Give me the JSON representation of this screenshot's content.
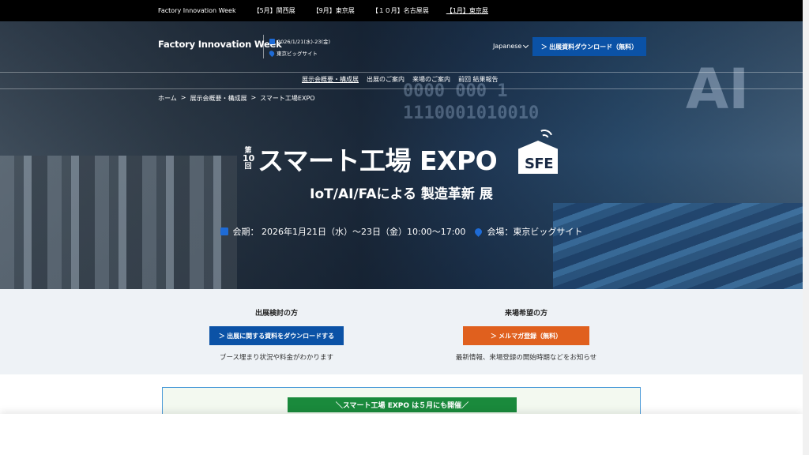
{
  "topbar": {
    "links": [
      {
        "label": "Factory Innovation Week",
        "active": false
      },
      {
        "label": "【5月】関西展",
        "active": false
      },
      {
        "label": "【9月】東京展",
        "active": false
      },
      {
        "label": "【１０月】名古屋展",
        "active": false
      },
      {
        "label": "【1月】東京展",
        "active": true
      }
    ]
  },
  "header": {
    "logo": "Factory Innovation Week",
    "date": "2026/1/21(水)-23(金)",
    "venue": "東京ビッグサイト",
    "language": "Japanese",
    "download_button": "＞ 出展資料ダウンロード（無料）"
  },
  "nav": {
    "items": [
      {
        "label": "展示会概要・構成展",
        "active": true
      },
      {
        "label": "出展のご案内",
        "active": false
      },
      {
        "label": "来場のご案内",
        "active": false
      },
      {
        "label": "前回 結果報告",
        "active": false
      }
    ]
  },
  "breadcrumb": {
    "home": "ホーム",
    "sep1": ">",
    "overview": "展示会概要・構成展",
    "sep2": ">",
    "current": "スマート工場EXPO"
  },
  "hero": {
    "edition_top": "第",
    "edition_num": "10",
    "edition_bottom": "回",
    "title": "スマート工場 EXPO",
    "logo_text": "SFE",
    "subtitle": "IoT/AI/FAによる 製造革新 展",
    "period": "会期： 2026年1月21日（水）〜23日（金）10:00〜17:00",
    "venue": "会場：東京ビッグサイト",
    "bg_binary_1": "0000 000 1",
    "bg_binary_2": "1110001010010",
    "bg_ai": "AI"
  },
  "cta": {
    "exhibitor": {
      "title": "出展検討の方",
      "button": "＞ 出展に関する資料をダウンロードする",
      "note": "ブース埋まり状況や料金がわかります"
    },
    "visitor": {
      "title": "来場希望の方",
      "button": "＞ メルマガ登録（無料）",
      "note": "最新情報、来場登録の開始時期などをお知らせ"
    }
  },
  "notice": {
    "label": "＼スマート工場 EXPO は５月にも開催／"
  },
  "colors": {
    "primary_blue": "#0b52a6",
    "orange": "#e0601e",
    "green": "#1a8a3c"
  }
}
